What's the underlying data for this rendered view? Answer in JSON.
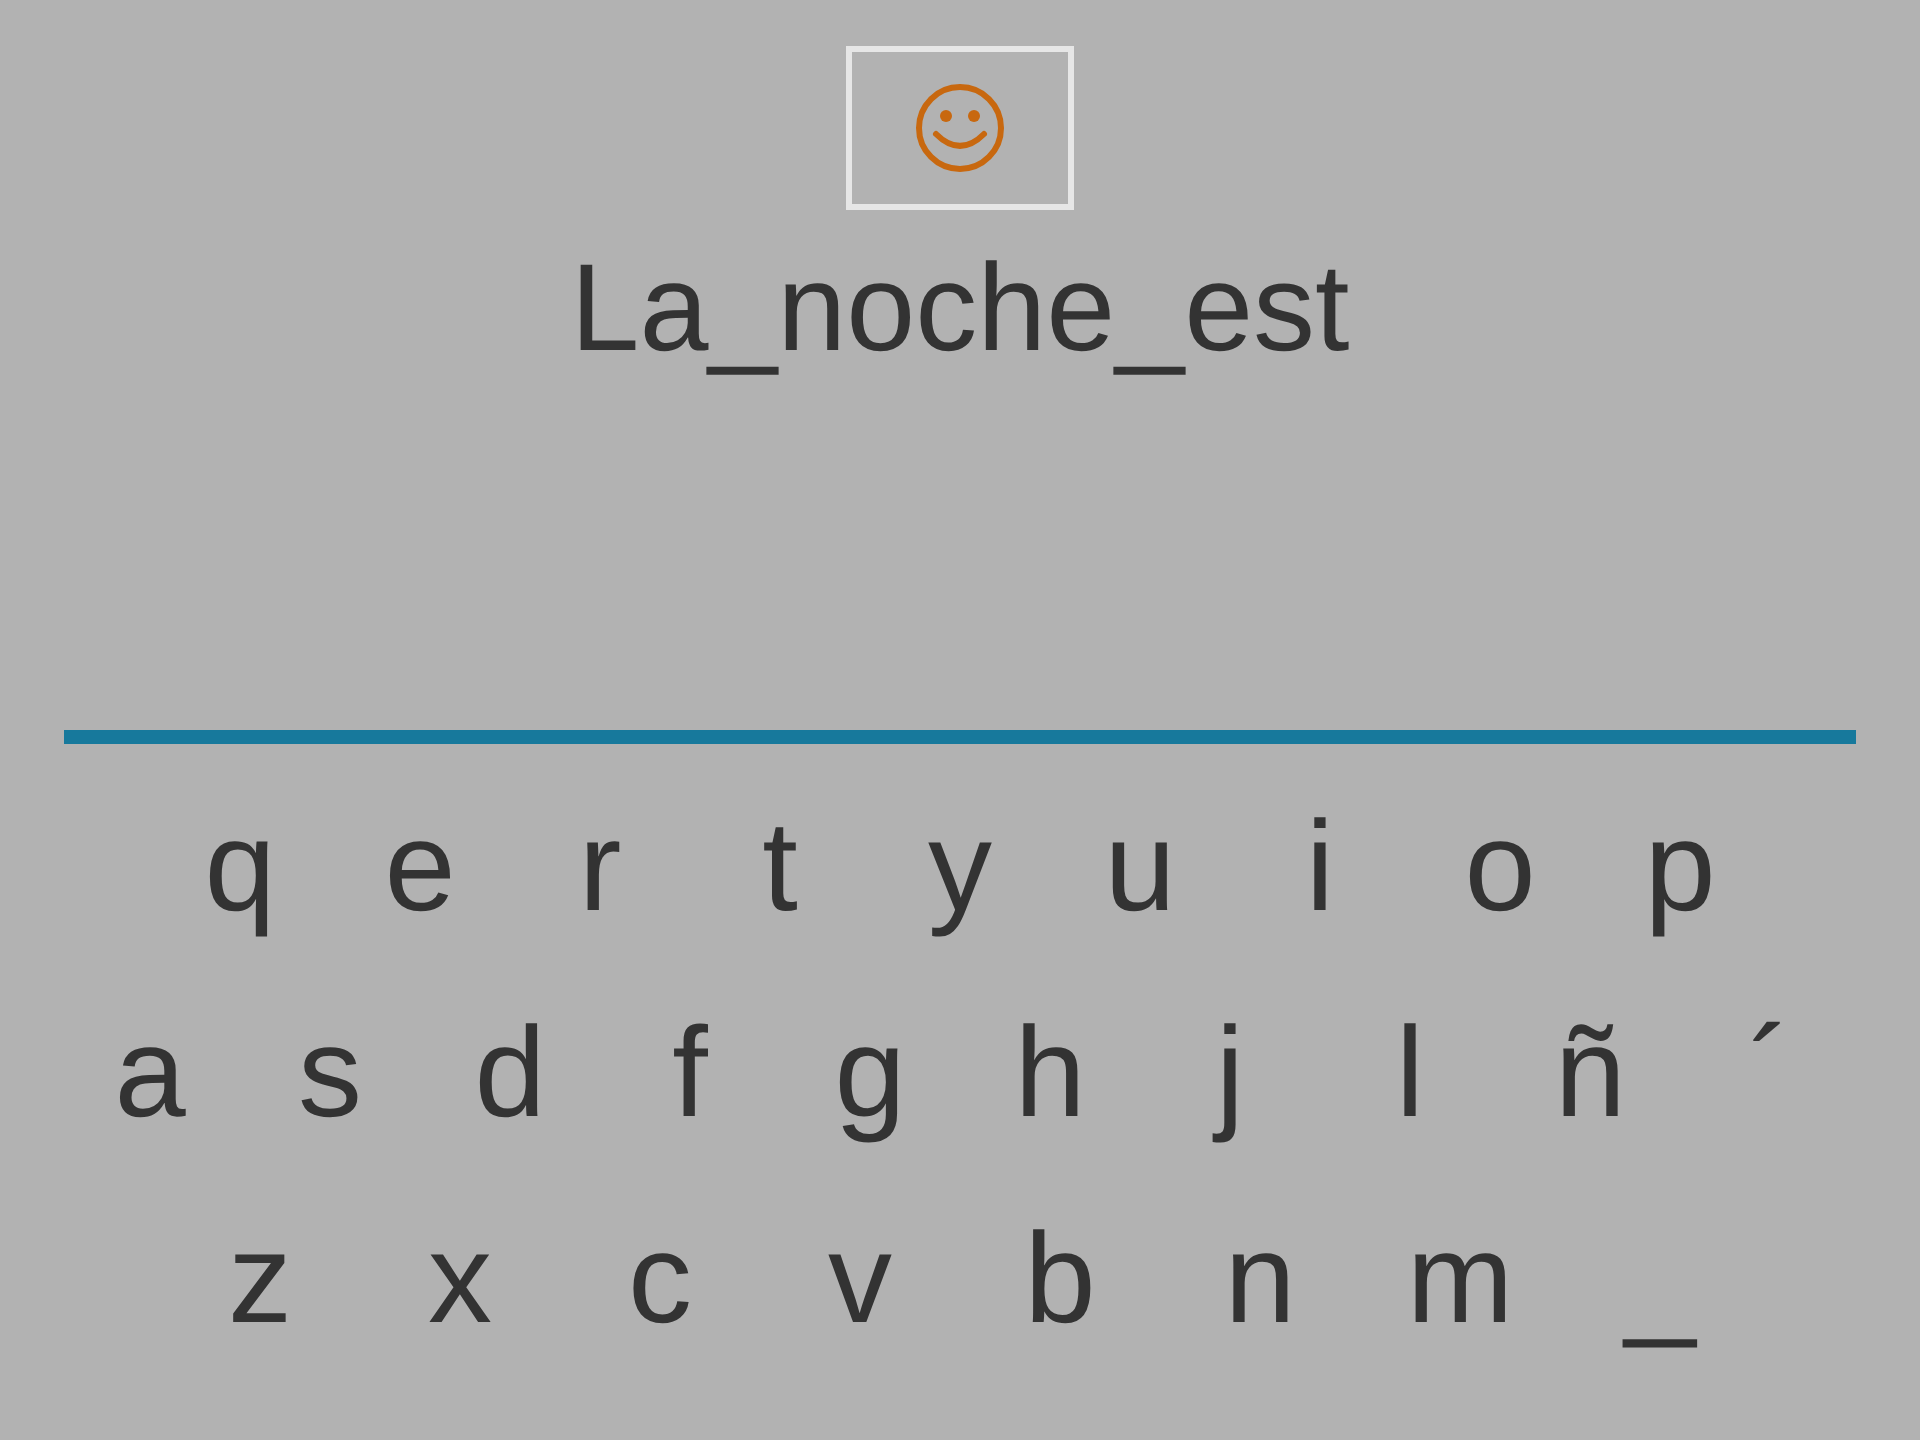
{
  "phrase": "La_noche_est",
  "keyboard": {
    "rows": [
      [
        "q",
        "e",
        "r",
        "t",
        "y",
        "u",
        "i",
        "o",
        "p"
      ],
      [
        "a",
        "s",
        "d",
        "f",
        "g",
        "h",
        "j",
        "l",
        "ñ",
        "´"
      ],
      [
        "z",
        "x",
        "c",
        "v",
        "b",
        "n",
        "m",
        "_"
      ]
    ]
  }
}
